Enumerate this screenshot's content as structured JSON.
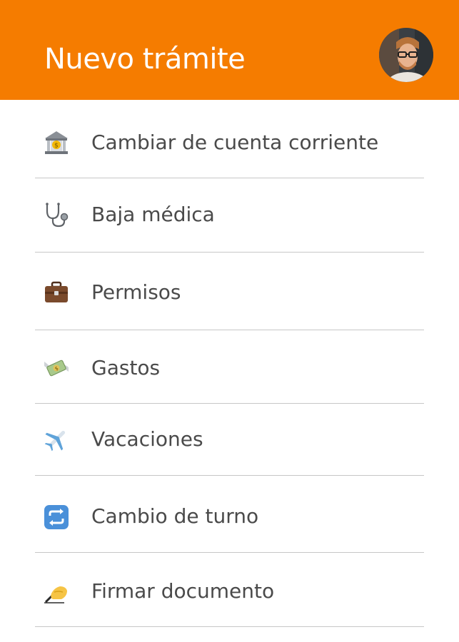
{
  "header": {
    "title": "Nuevo trámite",
    "background": "#f57c00",
    "avatar_icon": "user-avatar-photo"
  },
  "items": [
    {
      "label": "Cambiar de cuenta corriente",
      "icon": "bank-icon"
    },
    {
      "label": "Baja médica",
      "icon": "stethoscope-icon"
    },
    {
      "label": "Permisos",
      "icon": "briefcase-icon"
    },
    {
      "label": "Gastos",
      "icon": "money-with-wings-icon"
    },
    {
      "label": "Vacaciones",
      "icon": "airplane-icon"
    },
    {
      "label": "Cambio de turno",
      "icon": "repeat-icon"
    },
    {
      "label": "Firmar documento",
      "icon": "writing-hand-icon"
    }
  ]
}
